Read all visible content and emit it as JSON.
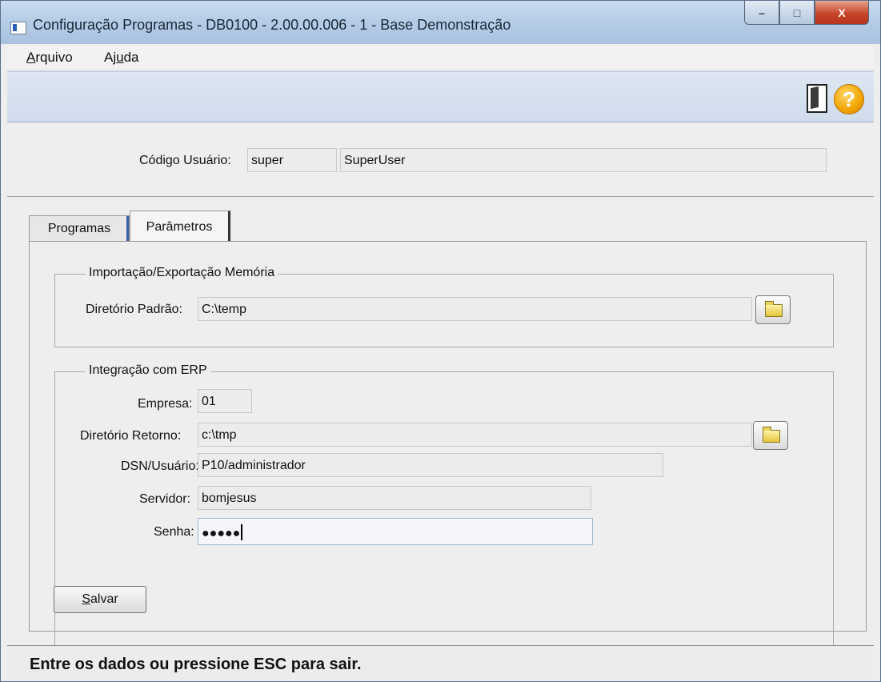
{
  "window": {
    "title": "Configuração Programas - DB0100 - 2.00.00.006 - 1 - Base Demonstração",
    "buttons": {
      "minimize": "–",
      "maximize": "□",
      "close": "X"
    }
  },
  "menubar": {
    "items": [
      {
        "label_pre": "",
        "label_ul": "A",
        "label_post": "rquivo"
      },
      {
        "label_pre": "Aj",
        "label_ul": "u",
        "label_post": "da"
      }
    ]
  },
  "toolbar": {
    "help_glyph": "?",
    "icons": [
      "exit-door-icon",
      "help-icon"
    ]
  },
  "user": {
    "code_label": "Código Usuário:",
    "code_value": "super",
    "name_value": "SuperUser"
  },
  "tabs": [
    {
      "label": "Programas",
      "active": false
    },
    {
      "label": "Parâmetros",
      "active": true
    }
  ],
  "import_export": {
    "title": "Importação/Exportação Memória",
    "dir_label": "Diretório Padrão:",
    "dir_value": "C:\\temp"
  },
  "erp": {
    "title": "Integração com ERP",
    "empresa_label": "Empresa:",
    "empresa_value": "01",
    "retorno_label": "Diretório Retorno:",
    "retorno_value": "c:\\tmp",
    "dsn_label": "DSN/Usuário:",
    "dsn_value": "P10/administrador",
    "servidor_label": "Servidor:",
    "servidor_value": "bomjesus",
    "senha_label": "Senha:",
    "senha_value": "●●●●●"
  },
  "save_button": {
    "label_ul": "S",
    "label_rest": "alvar"
  },
  "status": {
    "text": "Entre os dados ou pressione ESC para sair."
  },
  "colors": {
    "titlebar": "#b6cde7",
    "close_button": "#c7452a",
    "help_icon": "#f2a400"
  }
}
